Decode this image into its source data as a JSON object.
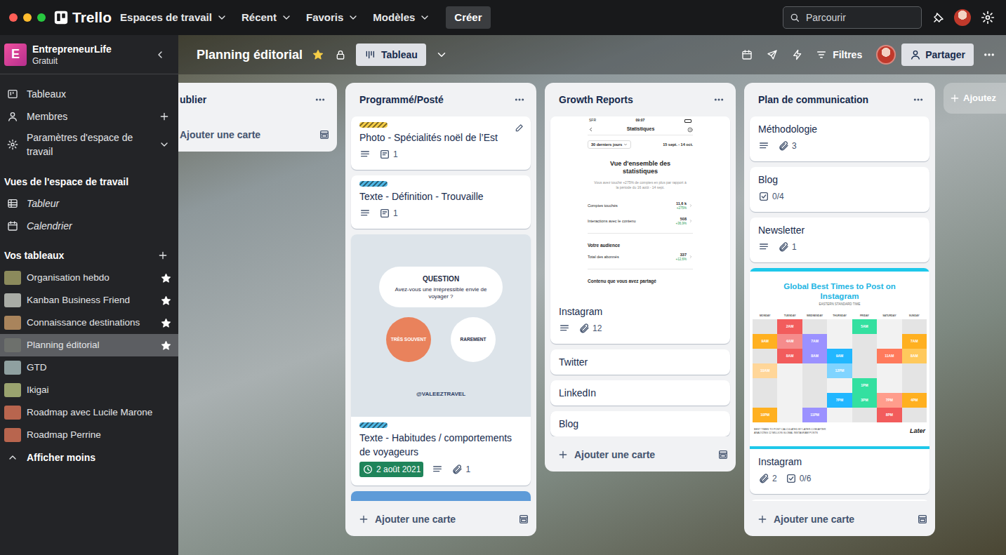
{
  "window": {
    "controls": [
      {
        "color": "#ff5f57"
      },
      {
        "color": "#febc2e"
      },
      {
        "color": "#28c840"
      }
    ]
  },
  "topbar": {
    "logo": "Trello",
    "menus": [
      {
        "label": "Espaces de travail"
      },
      {
        "label": "Récent"
      },
      {
        "label": "Favoris"
      },
      {
        "label": "Modèles"
      }
    ],
    "create": "Créer",
    "search": {
      "placeholder": "Parcourir"
    }
  },
  "sidebar": {
    "workspace": {
      "initial": "E",
      "name": "EntrepreneurLife",
      "plan": "Gratuit"
    },
    "nav": [
      {
        "label": "Tableaux",
        "kind": "boards"
      },
      {
        "label": "Membres",
        "kind": "members"
      },
      {
        "label": "Paramètres d'espace de travail",
        "kind": "settings"
      }
    ],
    "views_title": "Vues de l'espace de travail",
    "views": [
      {
        "label": "Tableur",
        "kind": "table"
      },
      {
        "label": "Calendrier",
        "kind": "calendar"
      }
    ],
    "boards_title": "Vos tableaux",
    "boards": [
      {
        "label": "Organisation hebdo",
        "starred": true,
        "selected": false,
        "color": "#8b8a5c"
      },
      {
        "label": "Kanban Business Friend",
        "starred": true,
        "selected": false,
        "color": "#a9aca6"
      },
      {
        "label": "Connaissance destinations",
        "starred": true,
        "selected": false,
        "color": "#a9845c"
      },
      {
        "label": "Planning éditorial",
        "starred": true,
        "selected": true,
        "color": "#6d706c"
      },
      {
        "label": "GTD",
        "starred": false,
        "selected": false,
        "color": "#8fa0a0"
      },
      {
        "label": "Ikigai",
        "starred": false,
        "selected": false,
        "color": "#9aa36f"
      },
      {
        "label": "Roadmap avec Lucile Marone",
        "starred": false,
        "selected": false,
        "color": "#b8654e"
      },
      {
        "label": "Roadmap Perrine",
        "starred": false,
        "selected": false,
        "color": "#b8654e"
      }
    ],
    "toggle": "Afficher moins"
  },
  "board": {
    "title": "Planning éditorial",
    "starred": true,
    "view": "Tableau",
    "filter": "Filtres",
    "share": "Partager"
  },
  "lists": [
    {
      "title": "ublier",
      "cards": [],
      "add_card": "Ajouter une carte"
    },
    {
      "title": "Programmé/Posté",
      "add_card": "Ajouter une carte",
      "cards": [
        {
          "kind": "text",
          "labels": [
            {
              "color": "#f5cd47"
            }
          ],
          "title": "Photo - Spécialités noël de l’Est",
          "hovered": true,
          "badges": [
            {
              "kind": "description"
            },
            {
              "kind": "cards",
              "text": "1"
            }
          ]
        },
        {
          "kind": "text",
          "labels": [
            {
              "color": "#4fb8e6"
            }
          ],
          "title": "Texte - Définition - Trouvaille",
          "hovered": false,
          "badges": [
            {
              "kind": "description"
            },
            {
              "kind": "cards",
              "text": "1"
            }
          ]
        },
        {
          "kind": "cover",
          "labels": [
            {
              "color": "#4fb8e6"
            }
          ],
          "title": "Texte - Habitudes / comportements de voyageurs",
          "hovered": false,
          "cover": {
            "kind": "question",
            "heading": "QUESTION",
            "question": "Avez-vous une irrépressible envie de voyager ?",
            "options": [
              {
                "label": "TRÈS SOUVENT",
                "selected": true
              },
              {
                "label": "RAREMENT",
                "selected": false
              }
            ],
            "handle": "@VALEEZTRAVEL"
          },
          "badges": [
            {
              "kind": "due",
              "text": "2 août 2021",
              "complete": true
            },
            {
              "kind": "description"
            },
            {
              "kind": "attachment",
              "text": "1"
            }
          ]
        },
        {
          "kind": "partial",
          "cover_color": "#5e9bd8"
        }
      ]
    },
    {
      "title": "Growth Reports",
      "add_card": "Ajouter une carte",
      "cards": [
        {
          "kind": "cover",
          "labels": [],
          "title": "Instagram",
          "hovered": false,
          "cover": {
            "kind": "stats",
            "carrier": "SFR",
            "time": "09:07",
            "title": "Statistiques",
            "period": "30 derniers jours",
            "range": "15 sept. - 14 oct.",
            "heading": "Vue d'ensemble des statistiques",
            "summary": "Vous avez touché +275% de comptes en plus par rapport à la période du 16 août - 14 sept.",
            "metrics": [
              {
                "label": "Comptes touchés",
                "value": "11,6 k",
                "change": "+275%"
              },
              {
                "label": "Interactions avec le contenu",
                "value": "508",
                "change": "+36,9%"
              }
            ],
            "audience": {
              "title": "Votre audience",
              "metrics": [
                {
                  "label": "Total des abonnés",
                  "value": "337",
                  "change": "+12,6%"
                }
              ]
            },
            "content_title": "Contenu que vous avez partagé"
          },
          "badges": [
            {
              "kind": "description"
            },
            {
              "kind": "attachment",
              "text": "12"
            }
          ]
        },
        {
          "kind": "text",
          "labels": [],
          "title": "Twitter",
          "hovered": false,
          "badges": []
        },
        {
          "kind": "text",
          "labels": [],
          "title": "LinkedIn",
          "hovered": false,
          "badges": []
        },
        {
          "kind": "text",
          "labels": [],
          "title": "Blog",
          "hovered": false,
          "badges": []
        }
      ]
    },
    {
      "title": "Plan de communication",
      "add_card": "Ajouter une carte",
      "cards": [
        {
          "kind": "text",
          "labels": [],
          "title": "Méthodologie",
          "hovered": false,
          "badges": [
            {
              "kind": "description"
            },
            {
              "kind": "attachment",
              "text": "3"
            }
          ]
        },
        {
          "kind": "text",
          "labels": [],
          "title": "Blog",
          "hovered": false,
          "badges": [
            {
              "kind": "checklist",
              "text": "0/4"
            }
          ]
        },
        {
          "kind": "text",
          "labels": [],
          "title": "Newsletter",
          "hovered": false,
          "badges": [
            {
              "kind": "description"
            },
            {
              "kind": "attachment",
              "text": "1"
            }
          ]
        },
        {
          "kind": "cover",
          "labels": [],
          "title": "Instagram",
          "hovered": false,
          "cover": {
            "kind": "chart",
            "title": "Global Best Times to Post on Instagram",
            "subtitle": "EASTERN STANDARD TIME",
            "days": [
              "MONDAY",
              "TUESDAY",
              "WEDNESDAY",
              "THURSDAY",
              "FRIDAY",
              "SATURDAY",
              "SUNDAY"
            ],
            "slots": [
              [
                null,
                {
                  "text": "2AM",
                  "color": "#f25c5c"
                },
                null,
                null,
                {
                  "text": "5AM",
                  "color": "#33e0a0"
                },
                null,
                null
              ],
              [
                {
                  "text": "9AM",
                  "color": "#ffb020"
                },
                {
                  "text": "4AM",
                  "color": "#f58c8c"
                },
                {
                  "text": "7AM",
                  "color": "#9b91ff"
                },
                null,
                null,
                null,
                {
                  "text": "7AM",
                  "color": "#ffb020"
                }
              ],
              [
                null,
                {
                  "text": "8AM",
                  "color": "#f25c5c"
                },
                {
                  "text": "8AM",
                  "color": "#9b91ff"
                },
                {
                  "text": "9AM",
                  "color": "#22b7ff"
                },
                null,
                {
                  "text": "11AM",
                  "color": "#ff7a5c"
                },
                {
                  "text": "8AM",
                  "color": "#ffc95c"
                }
              ],
              [
                {
                  "text": "10AM",
                  "color": "#ffd699"
                },
                null,
                null,
                {
                  "text": "12PM",
                  "color": "#80d4ff"
                },
                null,
                null,
                null
              ],
              [
                null,
                null,
                null,
                null,
                {
                  "text": "1PM",
                  "color": "#33e0a0"
                },
                null,
                null
              ],
              [
                null,
                null,
                null,
                {
                  "text": "7PM",
                  "color": "#22b7ff"
                },
                {
                  "text": "3PM",
                  "color": "#33e0a0"
                },
                {
                  "text": "7PM",
                  "color": "#ff9d8c"
                },
                {
                  "text": "4PM",
                  "color": "#ffb020"
                }
              ],
              [
                {
                  "text": "10PM",
                  "color": "#ffb020"
                },
                null,
                {
                  "text": "11PM",
                  "color": "#9b91ff"
                },
                null,
                null,
                {
                  "text": "8PM",
                  "color": "#f25c5c"
                },
                null
              ]
            ],
            "note": "BEST TIMES TO POST CALCULATED BY LATER.COM AFTER ANALYZING 12 MILLION GLOBAL INSTAGRAM POSTS",
            "brand": "Later"
          },
          "badges": [
            {
              "kind": "attachment",
              "text": "2"
            },
            {
              "kind": "checklist",
              "text": "0/6"
            }
          ]
        },
        {
          "kind": "partial"
        }
      ]
    }
  ],
  "add_list": "Ajoutez"
}
